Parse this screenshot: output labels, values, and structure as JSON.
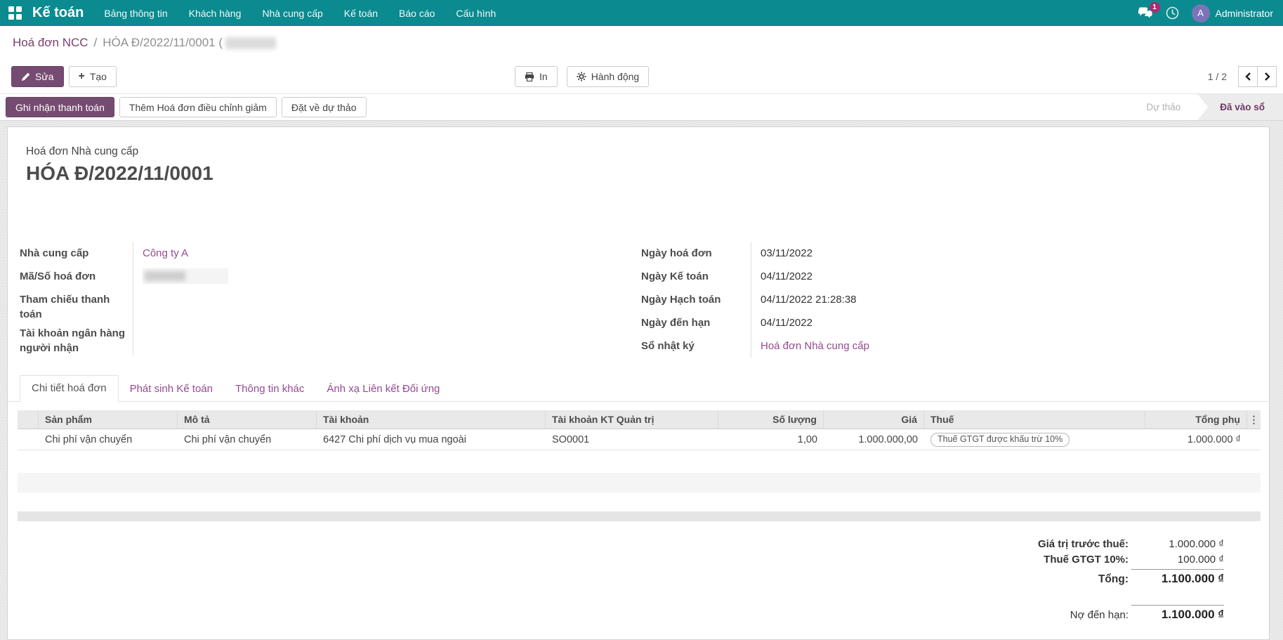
{
  "nav": {
    "brand": "Kế toán",
    "items": [
      "Bảng thông tin",
      "Khách hàng",
      "Nhà cung cấp",
      "Kế toán",
      "Báo cáo",
      "Cấu hình"
    ],
    "messages_badge": "1",
    "user_initial": "A",
    "user_name": "Administrator"
  },
  "breadcrumb": {
    "parent": "Hoá đơn NCC",
    "separator": "/",
    "current": "HÓA Đ/2022/11/0001 ("
  },
  "controls": {
    "edit": "Sửa",
    "create": "Tạo",
    "print": "In",
    "action": "Hành động",
    "pager": "1 / 2"
  },
  "status": {
    "register_payment": "Ghi nhận thanh toán",
    "add_credit_note": "Thêm Hoá đơn điều chỉnh giảm",
    "reset_draft": "Đặt về dự thảo",
    "stage_draft": "Dự thảo",
    "stage_posted": "Đã vào sổ"
  },
  "invoice": {
    "type_label": "Hoá đơn Nhà cung cấp",
    "name": "HÓA Đ/2022/11/0001",
    "supplier_label": "Nhà cung cấp",
    "supplier": "Công ty A",
    "ref_label": "Mã/Số hoá đơn",
    "payment_ref_label": "Tham chiếu thanh toán",
    "bank_label": "Tài khoản ngân hàng người nhận",
    "invoice_date_label": "Ngày hoá đơn",
    "invoice_date": "03/11/2022",
    "accounting_date_label": "Ngày Kế toán",
    "accounting_date": "04/11/2022",
    "posting_date_label": "Ngày Hạch toán",
    "posting_date": "04/11/2022 21:28:38",
    "due_date_label": "Ngày đến hạn",
    "due_date": "04/11/2022",
    "journal_label": "Sổ nhật ký",
    "journal": "Hoá đơn Nhà cung cấp"
  },
  "tabs": [
    "Chi tiết hoá đơn",
    "Phát sinh Kế toán",
    "Thông tin khác",
    "Ánh xạ Liên kết Đối ứng"
  ],
  "table": {
    "columns": {
      "product": "Sản phẩm",
      "description": "Mô tả",
      "account": "Tài khoản",
      "analytic": "Tài khoản KT Quản trị",
      "qty": "Số lượng",
      "price": "Giá",
      "tax": "Thuế",
      "subtotal": "Tổng phụ"
    },
    "rows": [
      {
        "product": "Chi phí vận chuyển",
        "description": "Chi phí vận chuyển",
        "account": "6427 Chi phí dịch vụ mua ngoài",
        "analytic": "SO0001",
        "qty": "1,00",
        "price": "1.000.000,00",
        "tax": "Thuế GTGT được khấu trừ 10%",
        "subtotal": "1.000.000 ₫"
      }
    ]
  },
  "totals": {
    "untaxed_label": "Giá trị trước thuế:",
    "untaxed": "1.000.000 ₫",
    "tax_label": "Thuế GTGT 10%:",
    "tax": "100.000 ₫",
    "total_label": "Tổng:",
    "total": "1.100.000 ₫",
    "due_label": "Nợ đến hạn:",
    "due": "1.100.000 ₫"
  },
  "icons": {
    "plus": "+",
    "dots": "⋮"
  },
  "colors": {
    "nav_teal": "#0b8a8f",
    "primary_purple": "#764b72",
    "link_purple": "#96498f",
    "badge_magenta": "#a92c6e"
  }
}
